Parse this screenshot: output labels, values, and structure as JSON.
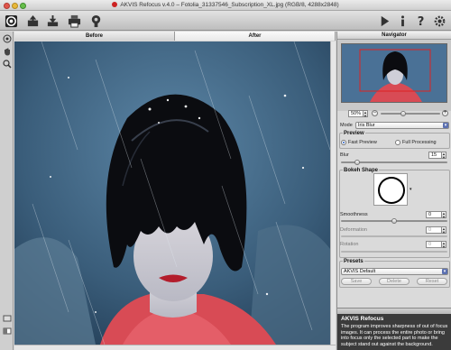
{
  "window": {
    "title": "AKVIS Refocus v.4.0 – Fotolia_31337546_Subscription_XL.jpg (RGB/8, 4288x2848)"
  },
  "toolbar": {
    "left_icons": [
      "refocus-logo-icon",
      "open-file-icon",
      "save-file-icon",
      "print-icon",
      "share-icon"
    ],
    "right_icons": [
      "run-icon",
      "info-icon",
      "help-icon",
      "settings-gear-icon"
    ]
  },
  "tabs": [
    {
      "label": "Before",
      "active": false
    },
    {
      "label": "After",
      "active": true
    }
  ],
  "navigator": {
    "title": "Navigator",
    "zoom": "50%"
  },
  "mode": {
    "label": "Mode",
    "value": "Iris Blur"
  },
  "preview": {
    "title": "Preview",
    "options": [
      "Fast Preview",
      "Full Processing"
    ],
    "selected": "Fast Preview"
  },
  "blur": {
    "label": "Blur",
    "value": "15",
    "level": 0.15
  },
  "bokeh": {
    "title": "Bokeh Shape",
    "smoothness_label": "Smoothness",
    "smoothness_value": "0",
    "deformation_label": "Deformation",
    "deformation_value": "0",
    "rotation_label": "Rotation",
    "rotation_value": "0"
  },
  "presets": {
    "title": "Presets",
    "value": "AKVIS Default",
    "save_label": "Save",
    "delete_label": "Delete",
    "reset_label": "Reset"
  },
  "help": {
    "title": "AKVIS Refocus",
    "body": "The program improves sharpness of out of focus images. It can process the entire photo or bring into focus only the selected part to make the subject stand out against the background."
  },
  "colors": {
    "accent": "#5a6fb0",
    "radio_selected": "#2a5fc2"
  }
}
